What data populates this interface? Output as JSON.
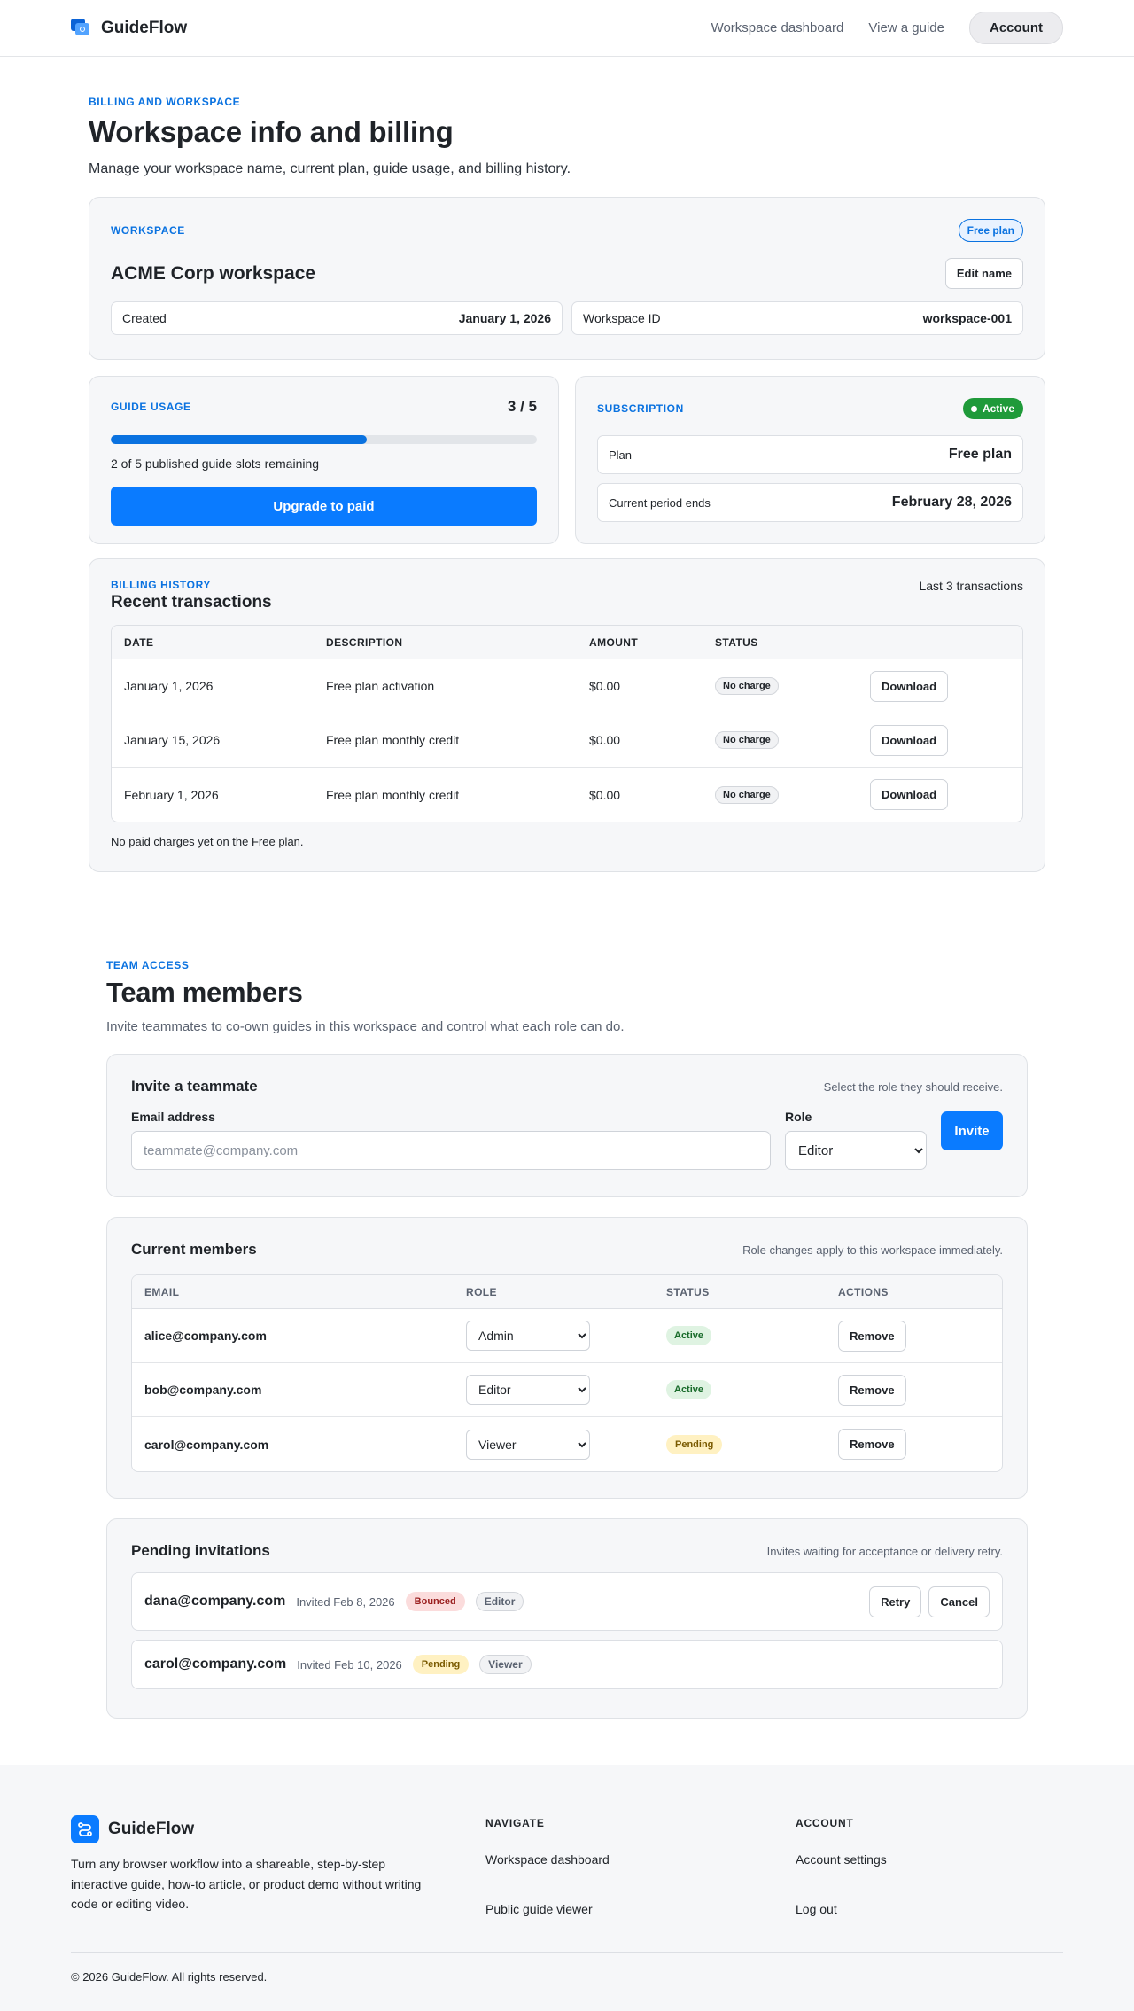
{
  "header": {
    "brand": "GuideFlow",
    "nav": [
      "Workspace dashboard",
      "View a guide"
    ],
    "account_label": "Account"
  },
  "billing": {
    "eyebrow": "Billing and workspace",
    "title": "Workspace info and billing",
    "subtitle": "Manage your workspace name, current plan, guide usage, and billing history.",
    "workspace": {
      "label": "Workspace",
      "plan_badge": "Free plan",
      "name": "ACME Corp workspace",
      "edit_label": "Edit name",
      "created_label": "Created",
      "created_value": "January 1, 2026",
      "id_label": "Workspace ID",
      "id_value": "workspace-001"
    },
    "usage": {
      "label": "Guide usage",
      "count": "3 / 5",
      "progress_fraction": 0.6,
      "note": "2 of 5 published guide slots remaining",
      "upgrade_label": "Upgrade to paid"
    },
    "subscription": {
      "label": "Subscription",
      "status": "Active",
      "plan_label": "Plan",
      "plan_value": "Free plan",
      "period_label": "Current period ends",
      "period_value": "February 28, 2026"
    },
    "history": {
      "eyebrow": "Billing history",
      "title": "Recent transactions",
      "count_note": "Last 3 transactions",
      "columns": [
        "Date",
        "Description",
        "Amount",
        "Status"
      ],
      "rows": [
        {
          "date": "January 1, 2026",
          "description": "Free plan activation",
          "amount": "$0.00",
          "status": "No charge",
          "action": "Download"
        },
        {
          "date": "January 15, 2026",
          "description": "Free plan monthly credit",
          "amount": "$0.00",
          "status": "No charge",
          "action": "Download"
        },
        {
          "date": "February 1, 2026",
          "description": "Free plan monthly credit",
          "amount": "$0.00",
          "status": "No charge",
          "action": "Download"
        }
      ],
      "footnote": "No paid charges yet on the Free plan."
    }
  },
  "team": {
    "eyebrow": "Team access",
    "title": "Team members",
    "subtitle": "Invite teammates to co-own guides in this workspace and control what each role can do.",
    "invite": {
      "title": "Invite a teammate",
      "hint": "Select the role they should receive.",
      "email_label": "Email address",
      "email_placeholder": "teammate@company.com",
      "email_value": "",
      "role_label": "Role",
      "role_value": "Editor",
      "invite_label": "Invite"
    },
    "members": {
      "title": "Current members",
      "hint": "Role changes apply to this workspace immediately.",
      "columns": [
        "Email",
        "Role",
        "Status",
        "Actions"
      ],
      "rows": [
        {
          "email": "alice@company.com",
          "role": "Admin",
          "status": "Active",
          "action": "Remove"
        },
        {
          "email": "bob@company.com",
          "role": "Editor",
          "status": "Active",
          "action": "Remove"
        },
        {
          "email": "carol@company.com",
          "role": "Viewer",
          "status": "Pending",
          "action": "Remove"
        }
      ]
    },
    "pending": {
      "title": "Pending invitations",
      "hint": "Invites waiting for acceptance or delivery retry.",
      "rows": [
        {
          "email": "dana@company.com",
          "date": "Invited Feb 8, 2026",
          "status": "Bounced",
          "role": "Editor",
          "retry": "Retry",
          "cancel": "Cancel"
        },
        {
          "email": "carol@company.com",
          "date": "Invited Feb 10, 2026",
          "status": "Pending",
          "role": "Viewer"
        }
      ]
    }
  },
  "footer": {
    "brand": "GuideFlow",
    "description": "Turn any browser workflow into a shareable, step-by-step interactive guide, how-to article, or product demo without writing code or editing video.",
    "navigate_title": "Navigate",
    "navigate_links": [
      "Workspace dashboard",
      "Public guide viewer"
    ],
    "account_title": "Account",
    "account_links": [
      "Account settings",
      "Log out"
    ],
    "copyright": "© 2026 GuideFlow. All rights reserved."
  },
  "colors": {
    "accent": "#0a7bff",
    "active_green": "#1f9a3a",
    "bounced_red": "#fbdcdc",
    "pending_yellow": "#fff1c2"
  }
}
